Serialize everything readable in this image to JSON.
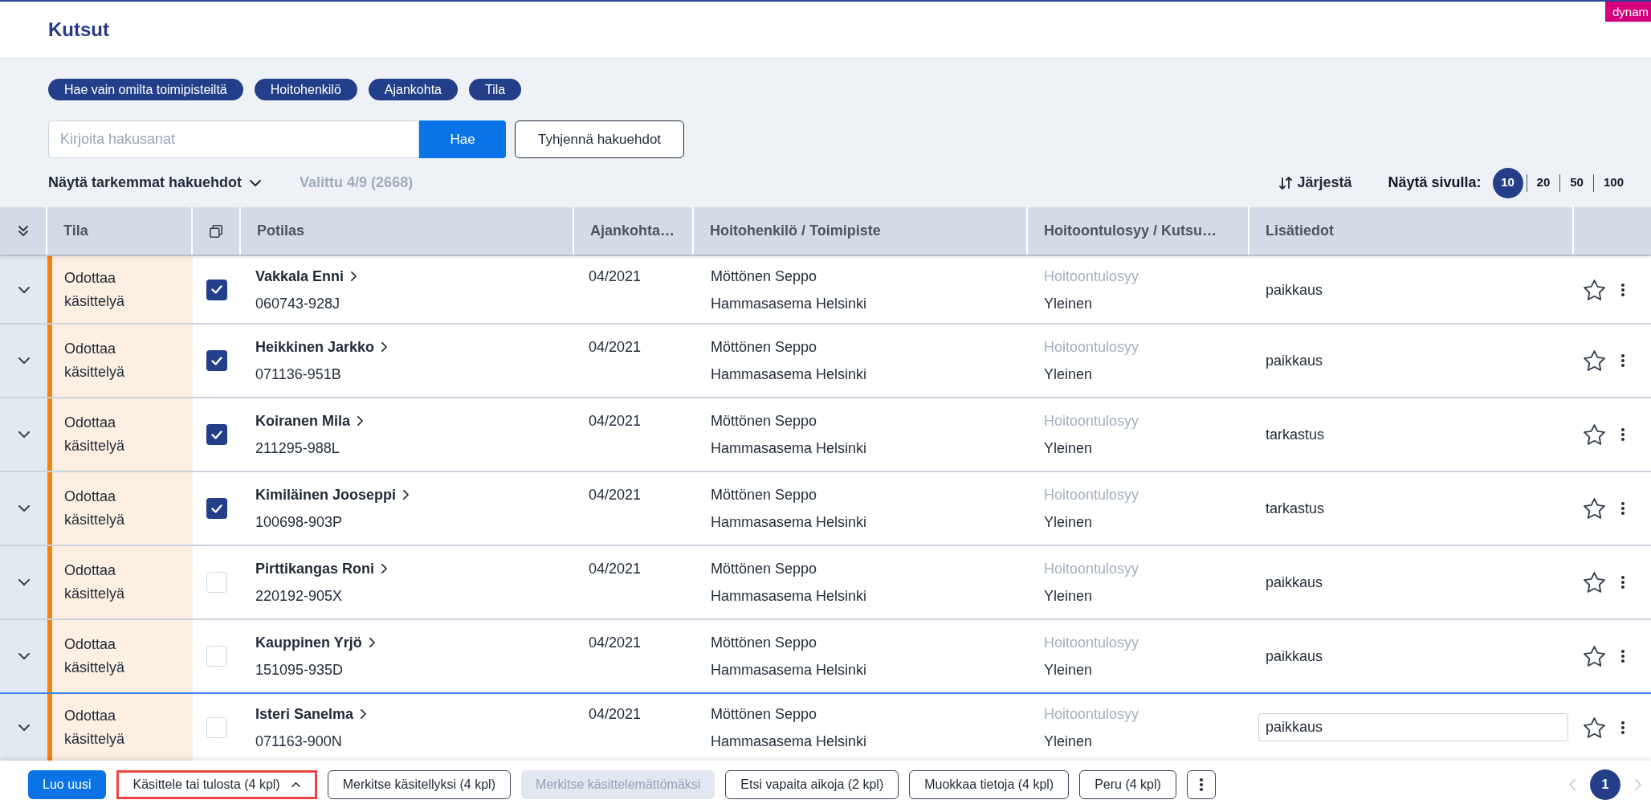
{
  "header": {
    "title": "Kutsut",
    "badge": "dynam"
  },
  "filters": {
    "chips": [
      {
        "label": "Hae vain omilta toimipisteiltä"
      },
      {
        "label": "Hoitohenkilö"
      },
      {
        "label": "Ajankohta"
      },
      {
        "label": "Tila"
      }
    ],
    "search": {
      "placeholder": "Kirjoita hakusanat",
      "button": "Hae"
    },
    "clear_button": "Tyhjennä hakuehdot",
    "more_filters": "Näytä tarkemmat hakuehdot",
    "selection_summary": "Valittu 4/9 (2668)",
    "sort_button": "Järjestä",
    "page_size": {
      "label": "Näytä sivulla:",
      "options": [
        {
          "label": "10",
          "selected": true
        },
        {
          "label": "20",
          "selected": false
        },
        {
          "label": "50",
          "selected": false
        },
        {
          "label": "100",
          "selected": false
        }
      ]
    }
  },
  "table": {
    "columns": [
      {
        "label": "Tila"
      },
      {
        "label": "Potilas"
      },
      {
        "label": "Ajankohta…"
      },
      {
        "label": "Hoitohenkilö / Toimipiste"
      },
      {
        "label": "Hoitoontulosyy / Kutsu…"
      },
      {
        "label": "Lisätiedot"
      }
    ],
    "rows": [
      {
        "status": "Odottaa käsittelyä",
        "checked": true,
        "name": "Vakkala Enni",
        "personal_id": "060743-928J",
        "date": "04/2021",
        "staff": "Möttönen Seppo",
        "clinic": "Hammasasema Helsinki",
        "reason_label": "Hoitoontulosyy",
        "reason": "Yleinen",
        "notes": "paikkaus",
        "editing": false,
        "starred": false
      },
      {
        "status": "Odottaa käsittelyä",
        "checked": true,
        "name": "Heikkinen Jarkko",
        "personal_id": "071136-951B",
        "date": "04/2021",
        "staff": "Möttönen Seppo",
        "clinic": "Hammasasema Helsinki",
        "reason_label": "Hoitoontulosyy",
        "reason": "Yleinen",
        "notes": "paikkaus",
        "editing": false,
        "starred": false
      },
      {
        "status": "Odottaa käsittelyä",
        "checked": true,
        "name": "Koiranen Mila",
        "personal_id": "211295-988L",
        "date": "04/2021",
        "staff": "Möttönen Seppo",
        "clinic": "Hammasasema Helsinki",
        "reason_label": "Hoitoontulosyy",
        "reason": "Yleinen",
        "notes": "tarkastus",
        "editing": false,
        "starred": false
      },
      {
        "status": "Odottaa käsittelyä",
        "checked": true,
        "name": "Kimiläinen Jooseppi",
        "personal_id": "100698-903P",
        "date": "04/2021",
        "staff": "Möttönen Seppo",
        "clinic": "Hammasasema Helsinki",
        "reason_label": "Hoitoontulosyy",
        "reason": "Yleinen",
        "notes": "tarkastus",
        "editing": false,
        "starred": false
      },
      {
        "status": "Odottaa käsittelyä",
        "checked": false,
        "name": "Pirttikangas Roni",
        "personal_id": "220192-905X",
        "date": "04/2021",
        "staff": "Möttönen Seppo",
        "clinic": "Hammasasema Helsinki",
        "reason_label": "Hoitoontulosyy",
        "reason": "Yleinen",
        "notes": "paikkaus",
        "editing": false,
        "starred": false
      },
      {
        "status": "Odottaa käsittelyä",
        "checked": false,
        "name": "Kauppinen Yrjö",
        "personal_id": "151095-935D",
        "date": "04/2021",
        "staff": "Möttönen Seppo",
        "clinic": "Hammasasema Helsinki",
        "reason_label": "Hoitoontulosyy",
        "reason": "Yleinen",
        "notes": "paikkaus",
        "editing": false,
        "starred": false
      },
      {
        "status": "Odottaa käsittelyä",
        "checked": false,
        "name": "Isteri Sanelma",
        "personal_id": "071163-900N",
        "date": "04/2021",
        "staff": "Möttönen Seppo",
        "clinic": "Hammasasema Helsinki",
        "reason_label": "Hoitoontulosyy",
        "reason": "Yleinen",
        "notes": "paikkaus",
        "editing": true,
        "starred": false
      }
    ]
  },
  "footer": {
    "actions": [
      {
        "label": "Luo uusi",
        "kind": "primary",
        "disabled": false,
        "highlighted": false
      },
      {
        "label": "Käsittele tai tulosta (4 kpl)",
        "kind": "dropdown",
        "disabled": false,
        "highlighted": true
      },
      {
        "label": "Merkitse käsitellyksi (4 kpl)",
        "kind": "outline",
        "disabled": false,
        "highlighted": false
      },
      {
        "label": "Merkitse käsittelemättömäksi",
        "kind": "outline",
        "disabled": true,
        "highlighted": false
      },
      {
        "label": "Etsi vapaita aikoja (2 kpl)",
        "kind": "outline",
        "disabled": false,
        "highlighted": false
      },
      {
        "label": "Muokkaa tietoja (4 kpl)",
        "kind": "outline",
        "disabled": false,
        "highlighted": false
      },
      {
        "label": "Peru (4 kpl)",
        "kind": "outline",
        "disabled": false,
        "highlighted": false
      },
      {
        "kind": "more",
        "disabled": false,
        "highlighted": false
      }
    ],
    "pagination": {
      "pages": [
        {
          "label": "1",
          "selected": true
        }
      ]
    }
  }
}
